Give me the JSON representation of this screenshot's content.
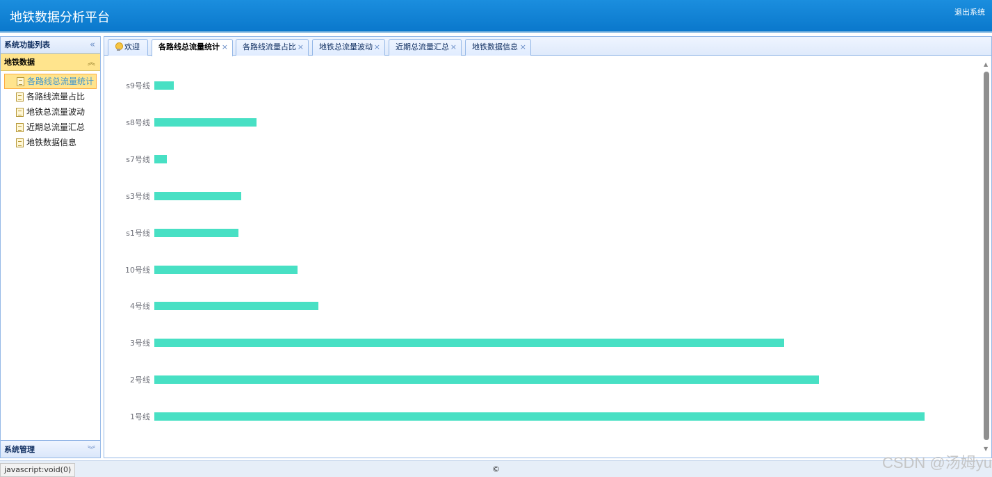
{
  "app": {
    "title": "地铁数据分析平台",
    "logout_label": "退出系统"
  },
  "sidebar": {
    "title": "系统功能列表",
    "section": "地铁数据",
    "items": [
      {
        "label": "各路线总流量统计"
      },
      {
        "label": "各路线流量占比"
      },
      {
        "label": "地铁总流量波动"
      },
      {
        "label": "近期总流量汇总"
      },
      {
        "label": "地铁数据信息"
      }
    ],
    "bottom_section": "系统管理"
  },
  "tabs": [
    {
      "label": "欢迎"
    },
    {
      "label": "各路线总流量统计"
    },
    {
      "label": "各路线流量占比"
    },
    {
      "label": "地铁总流量波动"
    },
    {
      "label": "近期总流量汇总"
    },
    {
      "label": "地铁数据信息"
    }
  ],
  "chart_data": {
    "type": "bar",
    "orientation": "horizontal",
    "categories": [
      "s9号线",
      "s8号线",
      "s7号线",
      "s3号线",
      "s1号线",
      "10号线",
      "4号线",
      "3号线",
      "2号线",
      "1号线"
    ],
    "values": [
      2.5,
      13.3,
      1.6,
      11.3,
      10.9,
      18.6,
      21.3,
      81.8,
      86.3,
      100
    ],
    "xlim": [
      0,
      100
    ],
    "grid": false,
    "bar_color": "#48e0c4"
  },
  "footer": {
    "copyright": "©"
  },
  "status": {
    "url": "javascript:void(0)"
  },
  "watermark": "CSDN @汤姆yu"
}
